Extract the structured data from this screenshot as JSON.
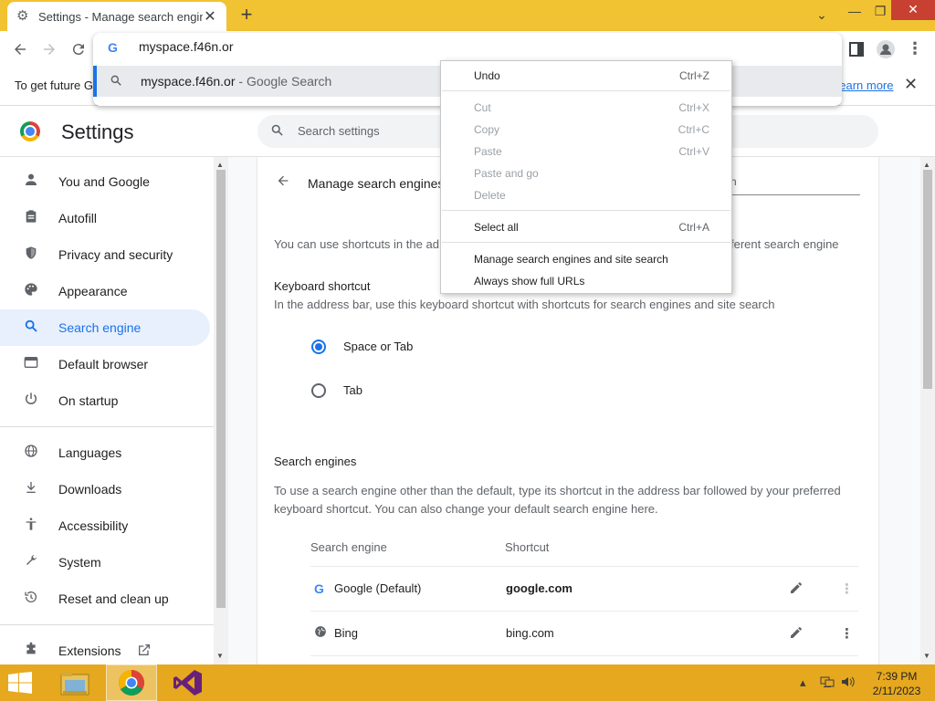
{
  "tab": {
    "title": "Settings - Manage search engine",
    "close": "✕"
  },
  "newtab": "+",
  "window": {
    "minimize": "—",
    "maximize": "❐",
    "close": "✕",
    "tab_search": "⌄"
  },
  "omnibox": {
    "input": "myspace.f46n.or",
    "suggestion": "myspace.f46n.or",
    "suggestion_suffix": " - Google Search"
  },
  "infobar": {
    "text": "To get future G",
    "link": "Learn more",
    "close": "✕"
  },
  "settings": {
    "title": "Settings",
    "search_placeholder": "Search settings"
  },
  "sidebar": {
    "items": [
      {
        "label": "You and Google",
        "icon": "person-icon"
      },
      {
        "label": "Autofill",
        "icon": "clipboard-icon"
      },
      {
        "label": "Privacy and security",
        "icon": "shield-icon"
      },
      {
        "label": "Appearance",
        "icon": "palette-icon"
      },
      {
        "label": "Search engine",
        "icon": "search-icon"
      },
      {
        "label": "Default browser",
        "icon": "browser-icon"
      },
      {
        "label": "On startup",
        "icon": "power-icon"
      },
      {
        "label": "Languages",
        "icon": "globe-icon"
      },
      {
        "label": "Downloads",
        "icon": "download-icon"
      },
      {
        "label": "Accessibility",
        "icon": "accessibility-icon"
      },
      {
        "label": "System",
        "icon": "wrench-icon"
      },
      {
        "label": "Reset and clean up",
        "icon": "history-icon"
      },
      {
        "label": "Extensions",
        "icon": "puzzle-icon"
      }
    ],
    "active": "Search engine"
  },
  "mse": {
    "title": "Manage search engines",
    "search_placeholder": "rch",
    "intro_left": "You can use shortcuts in the ad",
    "intro_right": "ferent search engine",
    "kb_heading": "Keyboard shortcut",
    "kb_desc": "In the address bar, use this keyboard shortcut with shortcuts for search engines and site search",
    "radio_space_tab": "Space or Tab",
    "radio_tab": "Tab",
    "se_heading": "Search engines",
    "se_desc_1": "To use a search engine other than the default, type its shortcut in the address bar followed by your preferred",
    "se_desc_2": "keyboard shortcut. You can also change your default search engine here.",
    "col_engine": "Search engine",
    "col_shortcut": "Shortcut",
    "engines": [
      {
        "name": "Google (Default)",
        "shortcut": "google.com"
      },
      {
        "name": "Bing",
        "shortcut": "bing.com"
      }
    ]
  },
  "context_menu": {
    "undo": {
      "label": "Undo",
      "key": "Ctrl+Z"
    },
    "cut": {
      "label": "Cut",
      "key": "Ctrl+X"
    },
    "copy": {
      "label": "Copy",
      "key": "Ctrl+C"
    },
    "paste": {
      "label": "Paste",
      "key": "Ctrl+V"
    },
    "paste_go": {
      "label": "Paste and go"
    },
    "delete": {
      "label": "Delete"
    },
    "select_all": {
      "label": "Select all",
      "key": "Ctrl+A"
    },
    "manage": {
      "label": "Manage search engines and site search"
    },
    "show_urls": {
      "label": "Always show full URLs"
    }
  },
  "taskbar": {
    "time": "7:39 PM",
    "date": "2/11/2023"
  },
  "colors": {
    "accent": "#1a73e8",
    "tabstrip": "#f1c232",
    "taskbar": "#e6a81e"
  }
}
